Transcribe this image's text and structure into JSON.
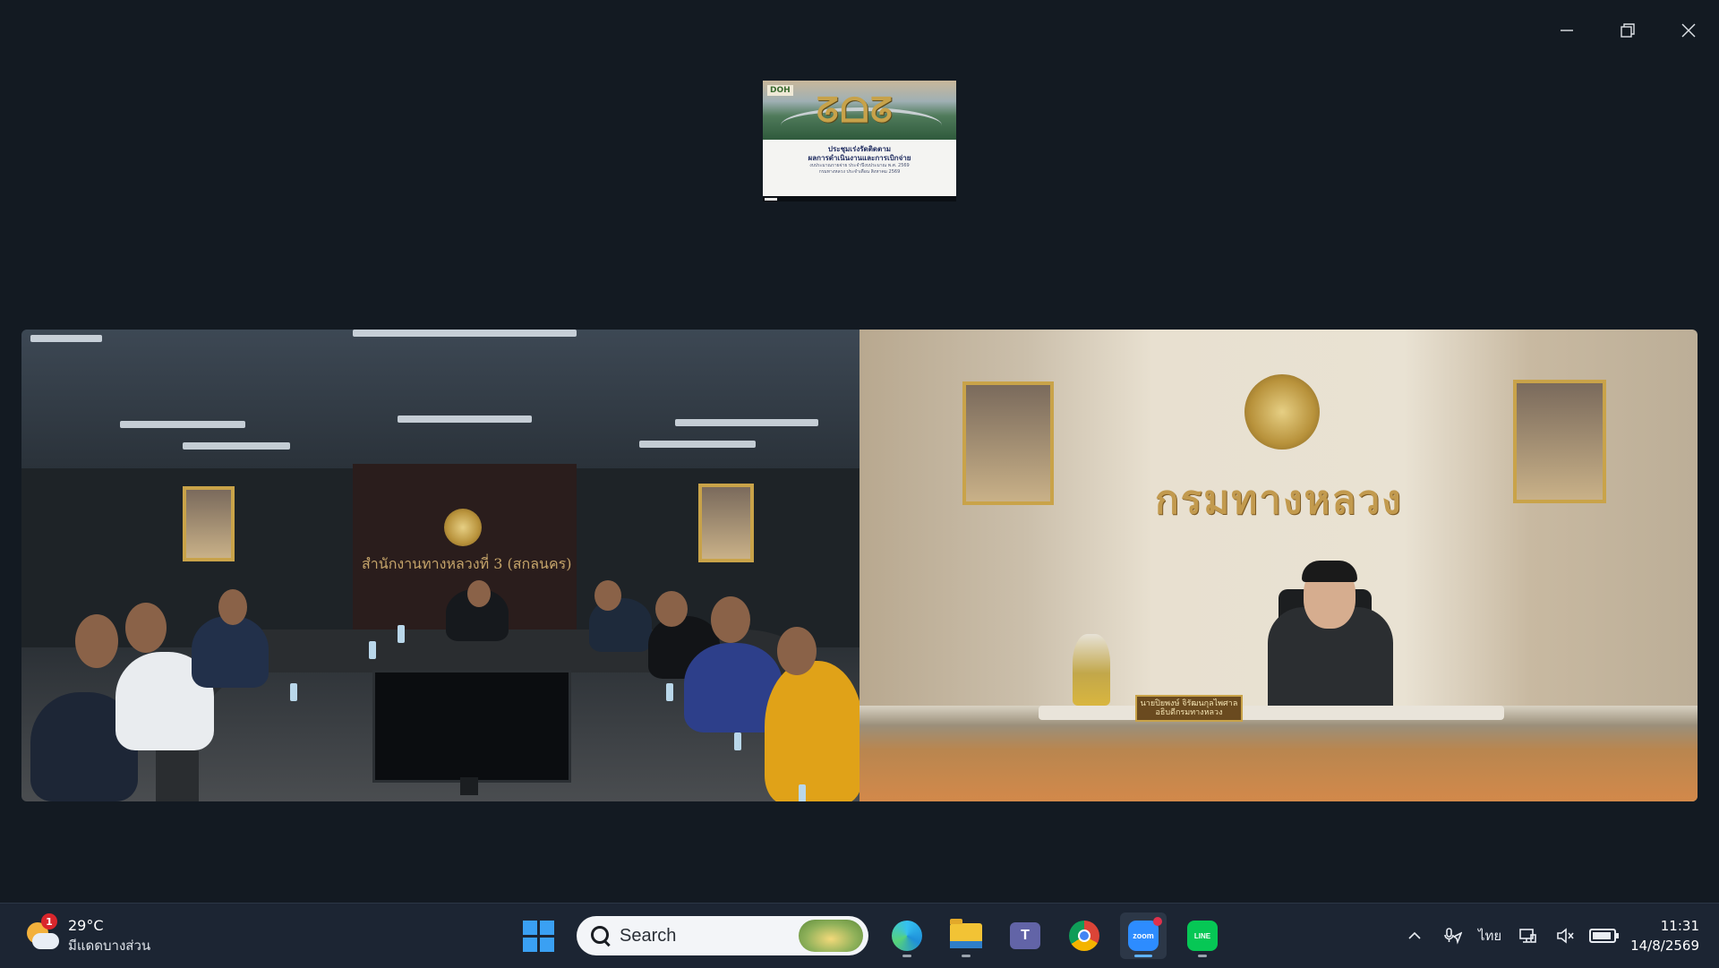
{
  "window": {
    "controls": {
      "minimize_icon": "minimize-icon",
      "restore_icon": "restore-icon",
      "close_icon": "close-icon"
    }
  },
  "shared_screen": {
    "slide_logo": "DOH",
    "slide_heading": "ประชุมเร่งรัดติดตาม",
    "slide_subheading": "ผลการดำเนินงานและการเบิกจ่าย",
    "slide_line1": "งบประมาณรายจ่าย ประจำปีงบประมาณ พ.ศ. 2569",
    "slide_line2": "กรมทางหลวง ประจำเดือน สิงหาคม 2569"
  },
  "video_left": {
    "room_sign": "สำนักงานทางหลวงที่ 3 (สกลนคร)"
  },
  "video_right": {
    "wall_title": "กรมทางหลวง",
    "nameplate_line1": "นายปิยพงษ์ จิรัฒนกุลไพศาล",
    "nameplate_line2": "อธิบดีกรมทางหลวง"
  },
  "taskbar": {
    "weather": {
      "badge_count": "1",
      "temperature": "29°C",
      "description": "มีแดดบางส่วน",
      "icon": "partly-sunny-icon"
    },
    "search": {
      "label": "Search"
    },
    "apps": [
      {
        "name": "Windows Start",
        "icon": "windows-start-icon"
      },
      {
        "name": "Microsoft Edge",
        "icon": "edge-icon"
      },
      {
        "name": "File Explorer",
        "icon": "file-explorer-icon"
      },
      {
        "name": "Microsoft Teams",
        "icon": "teams-icon"
      },
      {
        "name": "Google Chrome",
        "icon": "chrome-icon"
      },
      {
        "name": "Zoom",
        "icon": "zoom-icon",
        "label": "zoom"
      },
      {
        "name": "LINE",
        "icon": "line-icon",
        "label": "LINE"
      }
    ],
    "teams_letter": "T",
    "language": "ไทย",
    "clock": {
      "time": "11:31",
      "date": "14/8/2569"
    },
    "colors": {
      "taskbar_bg": "#1c2533",
      "accent": "#5fb2ff",
      "zoom": "#2d8cff",
      "line": "#06c755"
    }
  }
}
